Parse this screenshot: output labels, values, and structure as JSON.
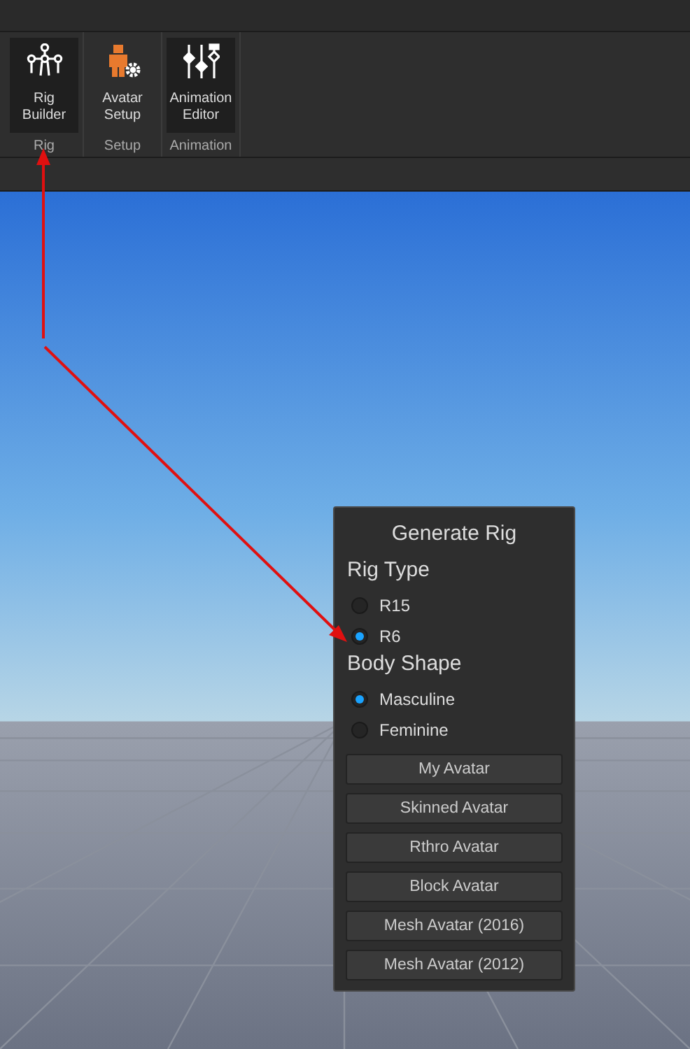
{
  "ribbon": {
    "groups": [
      {
        "label": "Rig",
        "tools": [
          {
            "kind": "rig",
            "lines": [
              "Rig",
              "Builder"
            ],
            "selected": true
          }
        ]
      },
      {
        "label": "Setup",
        "tools": [
          {
            "kind": "avatar",
            "lines": [
              "Avatar",
              "Setup"
            ],
            "selected": false
          }
        ]
      },
      {
        "label": "Animation",
        "tools": [
          {
            "kind": "animation",
            "lines": [
              "Animation",
              "Editor"
            ],
            "selected": true
          }
        ]
      }
    ]
  },
  "panel": {
    "title": "Generate Rig",
    "sections": [
      {
        "heading": "Rig Type",
        "options": [
          {
            "label": "R15",
            "selected": false
          },
          {
            "label": "R6",
            "selected": true
          }
        ]
      },
      {
        "heading": "Body Shape",
        "options": [
          {
            "label": "Masculine",
            "selected": true
          },
          {
            "label": "Feminine",
            "selected": false
          }
        ]
      }
    ],
    "buttons": [
      "My Avatar",
      "Skinned Avatar",
      "Rthro Avatar",
      "Block Avatar",
      "Mesh Avatar (2016)",
      "Mesh Avatar (2012)"
    ]
  }
}
